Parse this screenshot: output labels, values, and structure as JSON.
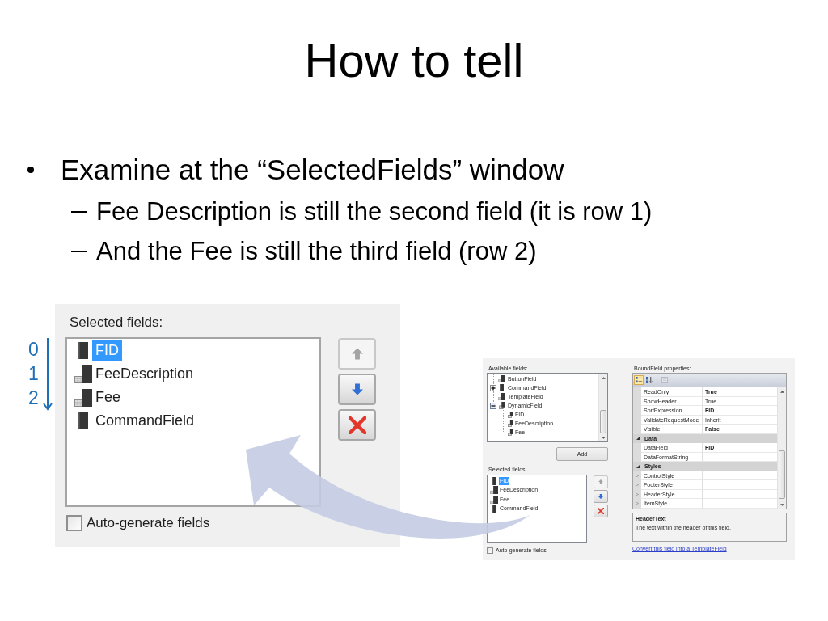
{
  "slide": {
    "title": "How to tell",
    "bullets": [
      {
        "text": "Examine at the “SelectedFields” window",
        "children": [
          {
            "text": "Fee Description is still the second field (it is row 1)"
          },
          {
            "text": "And the Fee is still the third field (row 2)"
          }
        ]
      }
    ]
  },
  "row_index": [
    "0",
    "1",
    "2"
  ],
  "zoomed_panel": {
    "label": "Selected fields:",
    "items": [
      {
        "text": "FID",
        "kind": "field",
        "selected": true
      },
      {
        "text": "FeeDescription",
        "kind": "grid-field",
        "selected": false
      },
      {
        "text": "Fee",
        "kind": "grid-field",
        "selected": false
      },
      {
        "text": "CommandField",
        "kind": "field",
        "selected": false
      }
    ],
    "buttons": [
      {
        "kind": "move-up",
        "disabled": true
      },
      {
        "kind": "move-down",
        "disabled": false
      },
      {
        "kind": "delete",
        "disabled": false
      }
    ],
    "auto_generate": {
      "label": "Auto-generate fields",
      "checked": false
    }
  },
  "fields_dialog": {
    "available": {
      "label": "Available fields:",
      "tree": [
        {
          "text": "ButtonField",
          "kind": "grid-field"
        },
        {
          "text": "CommandField",
          "kind": "field",
          "expanded": false
        },
        {
          "text": "TemplateField",
          "kind": "grid-field"
        },
        {
          "text": "DynamicField",
          "kind": "dynamic-field",
          "expanded": true,
          "children": [
            {
              "text": "FID",
              "kind": "dynamic-field"
            },
            {
              "text": "FeeDescription",
              "kind": "dynamic-field"
            },
            {
              "text": "Fee",
              "kind": "dynamic-field"
            }
          ]
        }
      ]
    },
    "add_button": "Add",
    "selected": {
      "label": "Selected fields:",
      "items": [
        {
          "text": "FID",
          "kind": "field",
          "selected": true
        },
        {
          "text": "FeeDescription",
          "kind": "grid-field",
          "selected": false
        },
        {
          "text": "Fee",
          "kind": "grid-field",
          "selected": false
        },
        {
          "text": "CommandField",
          "kind": "field",
          "selected": false
        }
      ],
      "buttons": [
        {
          "kind": "move-up",
          "disabled": true
        },
        {
          "kind": "move-down",
          "disabled": false
        },
        {
          "kind": "delete",
          "disabled": false
        }
      ]
    },
    "auto_generate": {
      "label": "Auto-generate fields",
      "checked": false
    },
    "properties": {
      "label": "BoundField properties:",
      "sort_modes": [
        {
          "kind": "categorized",
          "selected": true
        },
        {
          "kind": "alphabetical",
          "selected": false
        }
      ],
      "property_pages": {
        "disabled": true
      },
      "groups": [
        {
          "rows": [
            {
              "name": "ReadOnly",
              "value": "True",
              "modified": true
            },
            {
              "name": "ShowHeader",
              "value": "True",
              "modified": false
            },
            {
              "name": "SortExpression",
              "value": "FID",
              "modified": true
            },
            {
              "name": "ValidateRequestMode",
              "value": "Inherit",
              "modified": false
            },
            {
              "name": "Visible",
              "value": "False",
              "modified": true
            }
          ]
        },
        {
          "name": "Data",
          "expanded": true,
          "rows": [
            {
              "name": "DataField",
              "value": "FID",
              "modified": true
            },
            {
              "name": "DataFormatString"
            }
          ]
        },
        {
          "name": "Styles",
          "expanded": true,
          "rows": [
            {
              "name": "ControlStyle",
              "expanded": false
            },
            {
              "name": "FooterStyle",
              "expanded": false
            },
            {
              "name": "HeaderStyle",
              "expanded": false
            },
            {
              "name": "ItemStyle",
              "expanded": false
            }
          ]
        }
      ]
    },
    "description": {
      "title": "HeaderText",
      "text": "The text within the header of this field."
    },
    "link": "Convert this field into a TemplateField"
  }
}
